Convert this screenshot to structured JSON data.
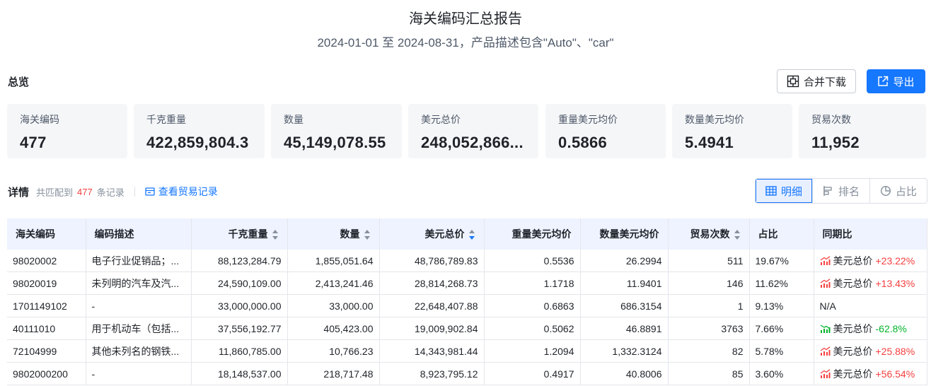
{
  "report": {
    "title": "海关编码汇总报告",
    "subtitle": "2024-01-01 至 2024-08-31，产品描述包含\"Auto\"、\"car\""
  },
  "overview": {
    "title": "总览",
    "merge_download_label": "合并下载",
    "export_label": "导出",
    "cards": [
      {
        "label": "海关编码",
        "value": "477"
      },
      {
        "label": "千克重量",
        "value": "422,859,804.3"
      },
      {
        "label": "数量",
        "value": "45,149,078.55"
      },
      {
        "label": "美元总价",
        "value": "248,052,866..."
      },
      {
        "label": "重量美元均价",
        "value": "0.5866"
      },
      {
        "label": "数量美元均价",
        "value": "5.4941"
      },
      {
        "label": "贸易次数",
        "value": "11,952"
      }
    ]
  },
  "details": {
    "title": "详情",
    "match_prefix": "共匹配到",
    "match_count": "477",
    "match_suffix": "条记录",
    "view_trade_link": "查看贸易记录",
    "views": [
      {
        "label": "明细",
        "active": true
      },
      {
        "label": "排名",
        "active": false
      },
      {
        "label": "占比",
        "active": false
      }
    ]
  },
  "table": {
    "columns": [
      "海关编码",
      "编码描述",
      "千克重量",
      "数量",
      "美元总价",
      "重量美元均价",
      "数量美元均价",
      "贸易次数",
      "占比",
      "同期比"
    ],
    "rows": [
      [
        "98020002",
        "电子行业促销品；...",
        "88,123,284.79",
        "1,855,051.64",
        "48,786,789.83",
        "0.5536",
        "26.2994",
        "511",
        "19.67%",
        "美元总价",
        "+23.22%"
      ],
      [
        "98020019",
        "未列明的汽车及汽...",
        "24,590,109.00",
        "2,413,241.46",
        "28,814,268.73",
        "1.1718",
        "11.9401",
        "146",
        "11.62%",
        "美元总价",
        "+13.43%"
      ],
      [
        "1701149102",
        "-",
        "33,000,000.00",
        "33,000.00",
        "22,648,407.88",
        "0.6863",
        "686.3154",
        "1",
        "9.13%",
        "N/A",
        ""
      ],
      [
        "40111010",
        "用于机动车（包括...",
        "37,556,192.77",
        "405,423.00",
        "19,009,902.84",
        "0.5062",
        "46.8891",
        "3763",
        "7.66%",
        "美元总价",
        "-62.8%"
      ],
      [
        "72104999",
        "其他未列名的钢铁...",
        "11,860,785.00",
        "10,766.23",
        "14,343,981.44",
        "1.2094",
        "1,332.3124",
        "82",
        "5.78%",
        "美元总价",
        "+25.88%"
      ],
      [
        "9802000200",
        "-",
        "18,148,537.00",
        "218,717.48",
        "8,923,795.12",
        "0.4917",
        "40.8006",
        "85",
        "3.60%",
        "美元总价",
        "+56.54%"
      ]
    ]
  },
  "colors": {
    "primary": "#1677ff",
    "up": "#f53f3f",
    "down": "#00b42a",
    "header_bg": "#eef3ff",
    "card_bg": "#f5f6f8"
  }
}
